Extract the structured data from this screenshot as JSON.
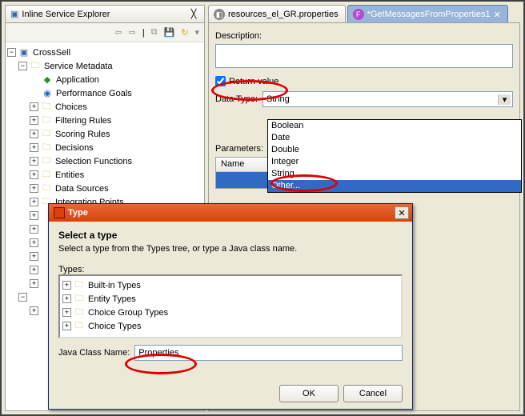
{
  "left": {
    "title": "Inline Service Explorer",
    "root": "CrossSell",
    "metadata": "Service Metadata",
    "app": "Application",
    "perf": "Performance Goals",
    "nodes": [
      "Choices",
      "Filtering Rules",
      "Scoring Rules",
      "Decisions",
      "Selection Functions",
      "Entities",
      "Data Sources",
      "Integration Points"
    ]
  },
  "editor": {
    "tabA": "resources_el_GR.properties",
    "tabB": "*GetMessagesFromProperties1",
    "desc_label": "Description:",
    "return_label": "Return value",
    "datatype_label": "Data Type:",
    "datatype_value": "String",
    "params_label": "Parameters:",
    "param_col": "Name",
    "options": [
      "Boolean",
      "Date",
      "Double",
      "Integer",
      "String",
      "Other..."
    ]
  },
  "dialog": {
    "title": "Type",
    "heading": "Select a type",
    "sub": "Select a type from the Types tree, or type a Java class name.",
    "types_label": "Types:",
    "type_nodes": [
      "Built-in Types",
      "Entity Types",
      "Choice Group Types",
      "Choice Types"
    ],
    "class_label": "Java Class Name:",
    "class_value": "Properties",
    "ok": "OK",
    "cancel": "Cancel"
  }
}
